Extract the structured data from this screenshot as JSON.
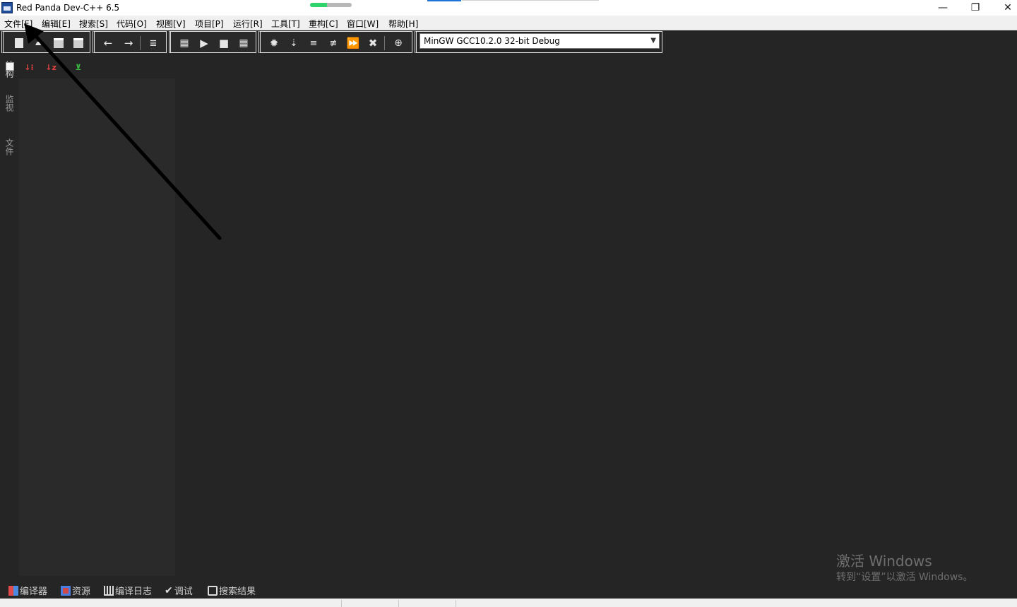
{
  "window": {
    "title": "Red Panda Dev-C++ 6.5",
    "minimize_glyph": "—",
    "restore_glyph": "❐",
    "close_glyph": "✕"
  },
  "menu": {
    "items": [
      "文件[F]",
      "编辑[E]",
      "搜索[S]",
      "代码[O]",
      "视图[V]",
      "项目[P]",
      "运行[R]",
      "工具[T]",
      "重构[C]",
      "窗口[W]",
      "帮助[H]"
    ]
  },
  "toolbar": {
    "compiler_selected": "MinGW GCC10.2.0 32-bit Debug"
  },
  "left_tabs": [
    "结构",
    "监视",
    "文件"
  ],
  "bottom_tabs": [
    "编译器",
    "资源",
    "编译日志",
    "调试",
    "搜索结果"
  ],
  "watermark": {
    "title": "激活 Windows",
    "subtitle": "转到“设置”以激活 Windows。"
  },
  "colors": {
    "background": "#252526",
    "panel": "#2a2a2a",
    "menubar": "#f0f0f0",
    "progress": "#2fd36b"
  },
  "icons": {
    "app": "dev-cpp-app-icon",
    "sort_a": "sort-by-type-icon",
    "sort_b": "sort-alpha-icon",
    "tree": "class-tree-icon"
  },
  "progress_fraction": 0.4
}
